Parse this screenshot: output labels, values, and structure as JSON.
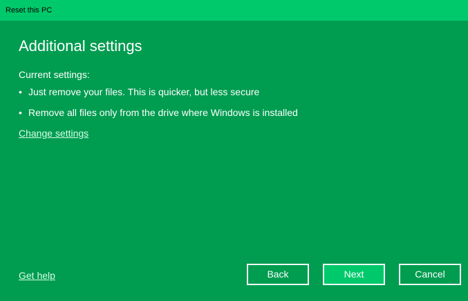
{
  "window": {
    "title": "Reset this PC"
  },
  "main": {
    "heading": "Additional settings",
    "current_settings_label": "Current settings:",
    "settings_items": [
      "Just remove your files. This is quicker, but less secure",
      "Remove all files only from the drive where Windows is installed"
    ],
    "bullet_glyph": "•",
    "change_settings_link": "Change settings"
  },
  "footer": {
    "help_link": "Get help",
    "back_label": "Back",
    "next_label": "Next",
    "cancel_label": "Cancel"
  },
  "colors": {
    "background": "#009c50",
    "titlebar": "#00c96b",
    "primary_button": "#00c96b",
    "text": "#ffffff",
    "link": "#d6ffe7"
  }
}
